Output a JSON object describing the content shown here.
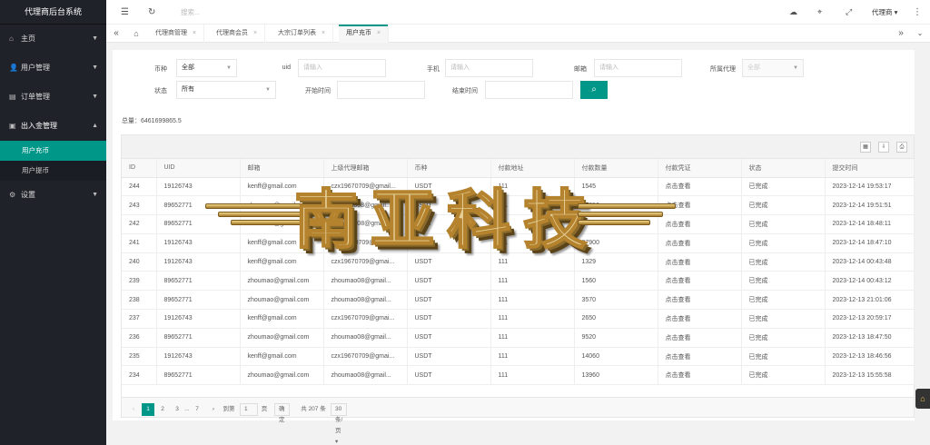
{
  "app": {
    "title": "代理商后台系统"
  },
  "sidebar": {
    "items": [
      {
        "label": "主页",
        "icon": "home-icon"
      },
      {
        "label": "用户管理",
        "icon": "user-icon"
      },
      {
        "label": "订单管理",
        "icon": "order-icon"
      },
      {
        "label": "出入金管理",
        "icon": "wallet-icon",
        "children": [
          {
            "label": "用户充币",
            "active": true
          },
          {
            "label": "用户提币",
            "active": false
          }
        ]
      },
      {
        "label": "设置",
        "icon": "gear-icon"
      }
    ]
  },
  "header": {
    "search_placeholder": "搜索...",
    "user": "代理商"
  },
  "tabs": [
    {
      "label": "代理商管理"
    },
    {
      "label": "代理商会员"
    },
    {
      "label": "大宗订单列表"
    },
    {
      "label": "用户充币",
      "active": true
    }
  ],
  "filters": {
    "currency_label": "币种",
    "currency_value": "全部",
    "uid_label": "uid",
    "uid_placeholder": "请输入",
    "phone_label": "手机",
    "phone_placeholder": "请输入",
    "email_label": "邮箱",
    "email_placeholder": "请输入",
    "agent_label": "所属代理",
    "agent_value": "全部",
    "status_label": "状态",
    "status_value": "所有",
    "start_label": "开始时间",
    "end_label": "结束时间"
  },
  "summary": {
    "total": "总量：6461699865.5"
  },
  "table": {
    "columns": [
      "ID",
      "UID",
      "邮箱",
      "上级代理邮箱",
      "币种",
      "付款地址",
      "付款数量",
      "付款凭证",
      "状态",
      "提交时间"
    ],
    "rows": [
      [
        "244",
        "19126743",
        "kenff@gmail.com",
        "czx19670709@gmail...",
        "USDT",
        "111",
        "1545",
        "点击查看",
        "已完成",
        "2023-12-14 19:53:17"
      ],
      [
        "243",
        "89652771",
        "zhoumao@gmail.com",
        "zhoumao08@gmail...",
        "USDT",
        "111",
        "21250",
        "点击查看",
        "已完成",
        "2023-12-14 19:51:51"
      ],
      [
        "242",
        "89652771",
        "zhoumao@gmail.com",
        "zhoumao08@gmail...",
        "USDT",
        "111",
        "24570",
        "点击查看",
        "已完成",
        "2023-12-14 18:48:11"
      ],
      [
        "241",
        "19126743",
        "kenff@gmail.com",
        "czx19670709@gmail...",
        "USDT",
        "111",
        "27900",
        "点击查看",
        "已完成",
        "2023-12-14 18:47:10"
      ],
      [
        "240",
        "19126743",
        "kenff@gmail.com",
        "czx19670709@gmai...",
        "USDT",
        "111",
        "1329",
        "点击查看",
        "已完成",
        "2023-12-14 00:43:48"
      ],
      [
        "239",
        "89652771",
        "zhoumao@gmail.com",
        "zhoumao08@gmail...",
        "USDT",
        "111",
        "1560",
        "点击查看",
        "已完成",
        "2023-12-14 00:43:12"
      ],
      [
        "238",
        "89652771",
        "zhoumao@gmail.com",
        "zhoumao08@gmail...",
        "USDT",
        "111",
        "3570",
        "点击查看",
        "已完成",
        "2023-12-13 21:01:06"
      ],
      [
        "237",
        "19126743",
        "kenff@gmail.com",
        "czx19670709@gmai...",
        "USDT",
        "111",
        "2650",
        "点击查看",
        "已完成",
        "2023-12-13 20:59:17"
      ],
      [
        "236",
        "89652771",
        "zhoumao@gmail.com",
        "zhoumao08@gmail...",
        "USDT",
        "111",
        "9520",
        "点击查看",
        "已完成",
        "2023-12-13 18:47:50"
      ],
      [
        "235",
        "19126743",
        "kenff@gmail.com",
        "czx19670709@gmai...",
        "USDT",
        "111",
        "14060",
        "点击查看",
        "已完成",
        "2023-12-13 18:46:56"
      ],
      [
        "234",
        "89652771",
        "zhoumao@gmail.com",
        "zhoumao08@gmail...",
        "USDT",
        "111",
        "13960",
        "点击查看",
        "已完成",
        "2023-12-13 15:55:58"
      ]
    ]
  },
  "pagination": {
    "pages": [
      "1",
      "2",
      "3",
      "...",
      "7"
    ],
    "goto_label": "到第",
    "goto_value": "1",
    "page_unit": "页",
    "confirm": "确定",
    "total": "共 207 条",
    "per_page": "30 条/页"
  },
  "watermark": {
    "text": "南亚科技"
  }
}
